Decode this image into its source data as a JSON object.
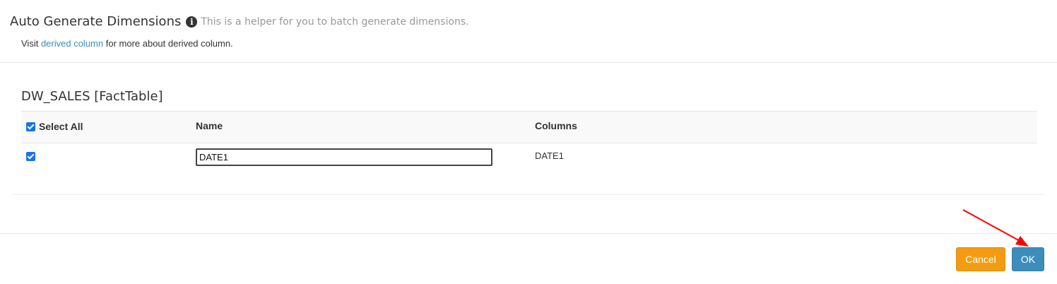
{
  "header": {
    "title": "Auto Generate Dimensions",
    "info_icon_glyph": "i",
    "helper_text": "This is a helper for you to batch generate dimensions.",
    "visit_prefix": "Visit",
    "visit_link": "derived column",
    "visit_suffix": "for more about derived column."
  },
  "table": {
    "title": "DW_SALES [FactTable]",
    "headers": {
      "select_all": "Select All",
      "name": "Name",
      "columns": "Columns"
    },
    "select_all_checked": true,
    "rows": [
      {
        "checked": true,
        "name": "DATE1",
        "column": "DATE1"
      }
    ]
  },
  "footer": {
    "cancel_label": "Cancel",
    "ok_label": "OK"
  },
  "colors": {
    "link": "#3c8dbc",
    "cancel": "#f39c12",
    "ok": "#3c8dbc",
    "checkbox": "#1a73e8",
    "annotation_arrow": "#ff0000"
  },
  "icons": {
    "info": "info-circle-icon",
    "annotation": "red-arrow-annotation"
  }
}
